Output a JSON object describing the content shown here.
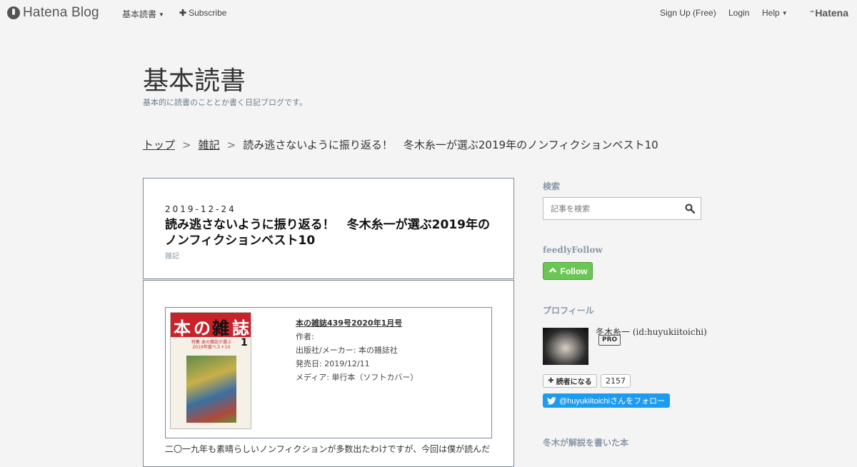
{
  "global_bar": {
    "logo_text": "Hatena Blog",
    "menu_kihon": "基本読書",
    "subscribe": "Subscribe",
    "signup": "Sign Up (Free)",
    "login": "Login",
    "help": "Help",
    "hatena": "Hatena"
  },
  "blog": {
    "title": "基本読書",
    "description": "基本的に読書のこととか書く日記ブログです。"
  },
  "breadcrumb": {
    "top": "トップ",
    "category": "雑記",
    "current": "読み逃さないように振り返る！　冬木糸一が選ぶ2019年のノンフィクションベスト10",
    "separator": ">"
  },
  "entry": {
    "date": "2019-12-24",
    "title": "読み逃さないように振り返る！　冬木糸一が選ぶ2019年のノンフィクションベスト10",
    "category": "雑記",
    "product": {
      "title": "本の雑誌439号2020年1月号",
      "author": "作者:",
      "publisher": "出版社/メーカー: 本の雑誌社",
      "release": "発売日: 2019/12/11",
      "media": "メディア: 単行本（ソフトカバー）"
    },
    "body_start": "二〇一九年も素晴らしいノンフィクションが多数出たわけですが、今回は僕が読んだ"
  },
  "cover": {
    "chars": [
      "本",
      "の",
      "雑",
      "誌"
    ],
    "number": "1",
    "subtitle": "特集 本の雑誌が選ぶ2019年度ベスト10"
  },
  "sidebar": {
    "search_heading": "検索",
    "search_placeholder": "記事を検索",
    "feedly_heading": "feedlyFollow",
    "feedly_button": "Follow",
    "profile_heading": "プロフィール",
    "profile_name": "冬木糸一 (id:huyukiitoichi)",
    "pro_badge": "PRO",
    "reader_button": "読者になる",
    "reader_count": "2157",
    "twitter_follow": "@huyukiitoichiさんをフォロー",
    "books_heading": "冬木が解説を書いた本"
  },
  "colors": {
    "background": "#f4f4f4",
    "feedly_green": "#6cc655",
    "twitter_blue": "#1d9bf0",
    "muted_heading": "#8a99a8"
  }
}
